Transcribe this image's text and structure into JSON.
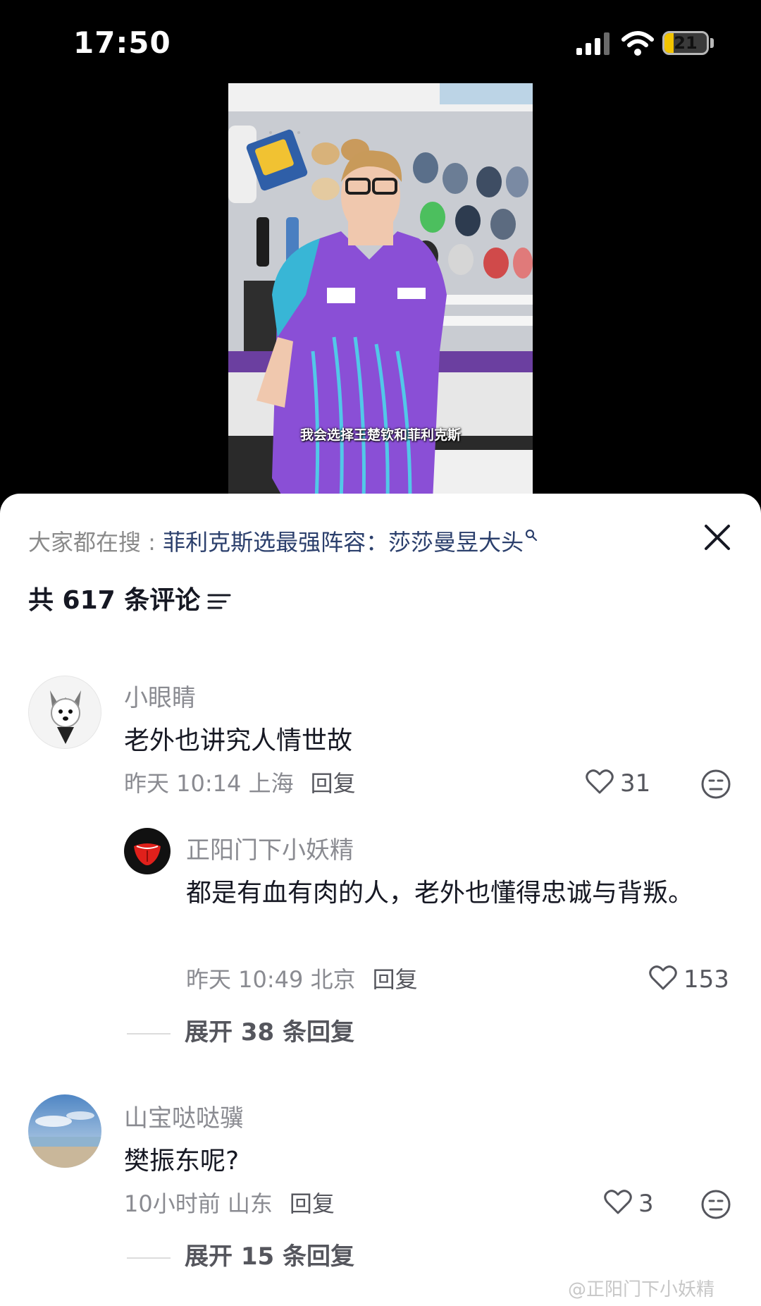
{
  "status_bar": {
    "time": "17:50",
    "battery": "21",
    "battery_level": 0.21
  },
  "video": {
    "caption": "我会选择王楚钦和菲利克斯"
  },
  "search": {
    "prefix": "大家都在搜 : ",
    "query": "菲利克斯选最强阵容：莎莎曼昱大头"
  },
  "header": {
    "count_label": "共 617 条评论"
  },
  "comments": [
    {
      "username": "小眼睛",
      "text": "老外也讲究人情世故",
      "time_location": "昨天 10:14 上海",
      "reply_label": "回复",
      "likes": "31",
      "replies": [
        {
          "username": "正阳门下小妖精",
          "text": "都是有血有肉的人，老外也懂得忠诚与背叛。",
          "time_location": "昨天 10:49 北京",
          "reply_label": "回复",
          "likes": "153"
        }
      ],
      "expand_label": "展开 38 条回复"
    },
    {
      "username": "山宝哒哒骥",
      "text": "樊振东呢?",
      "time_location": "10小时前 山东",
      "reply_label": "回复",
      "likes": "3",
      "expand_label": "展开 15 条回复"
    }
  ],
  "watermark": "@正阳门下小妖精",
  "colors": {
    "link": "#2b3f6c",
    "muted": "#8a8b91",
    "text": "#161823",
    "battery": "#f2c400"
  }
}
